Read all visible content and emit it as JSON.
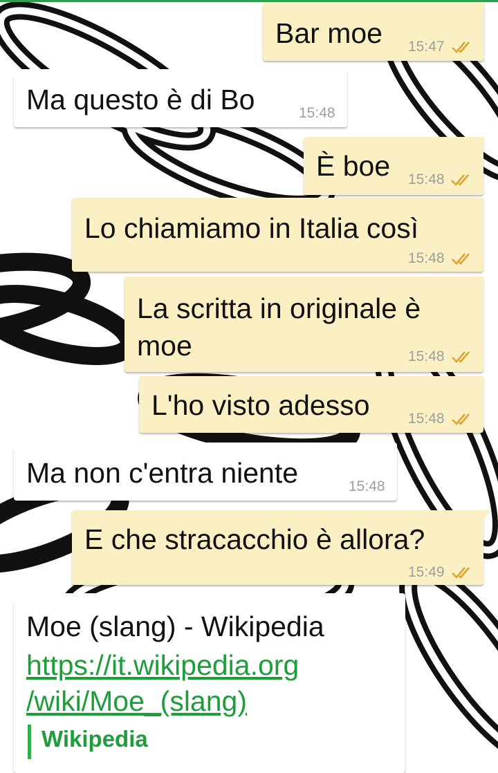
{
  "colors": {
    "outgoing_bubble": "#fbf0c3",
    "incoming_bubble": "#ffffff",
    "link": "#1e9e3a",
    "tick": "#e0a331",
    "timestamp": "#9aa0a0"
  },
  "messages": [
    {
      "direction": "out",
      "text": "Bar moe",
      "time": "15:47",
      "ticks": "double-check-icon"
    },
    {
      "direction": "in",
      "text": "Ma questo è di Bo",
      "time": "15:48"
    },
    {
      "direction": "out",
      "text": "È boe",
      "time": "15:48",
      "ticks": "double-check-icon"
    },
    {
      "direction": "out",
      "text": "Lo chiamiamo in Italia così",
      "time": "15:48",
      "ticks": "double-check-icon"
    },
    {
      "direction": "out",
      "text_line1": "La scritta in originale è",
      "text_line2": "moe",
      "time": "15:48",
      "ticks": "double-check-icon"
    },
    {
      "direction": "out",
      "text": "L'ho visto adesso",
      "time": "15:48",
      "ticks": "double-check-icon"
    },
    {
      "direction": "in",
      "text": "Ma non c'entra niente",
      "time": "15:48"
    },
    {
      "direction": "out",
      "text": "E che stracacchio è allora?",
      "time": "15:49",
      "ticks": "double-check-icon"
    }
  ],
  "link_message": {
    "direction": "in",
    "title": "Moe (slang) - Wikipedia",
    "url_line1": "https://it.wikipedia.org",
    "url_line2": "/wiki/Moe_(slang)",
    "preview_site": "Wikipedia"
  }
}
